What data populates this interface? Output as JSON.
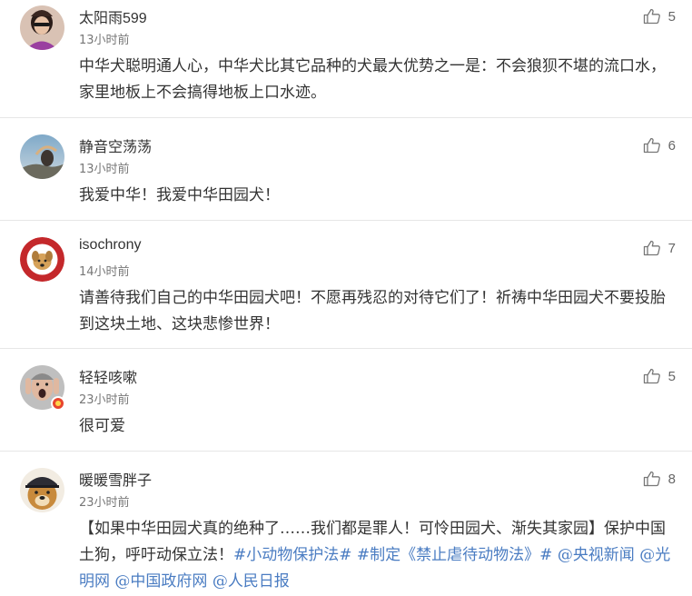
{
  "comments": [
    {
      "username": "太阳雨599",
      "time": "13小时前",
      "likes": "5",
      "text": "中华犬聪明通人心，中华犬比其它品种的犬最大优势之一是：不会狼狈不堪的流口水，家里地板上不会搞得地板上口水迹。",
      "avatar": "avatar-woman-sunglasses"
    },
    {
      "username": "静音空荡荡",
      "time": "13小时前",
      "likes": "6",
      "text": "我爱中华！我爱中华田园犬！",
      "avatar": "avatar-sky-photo"
    },
    {
      "username": "isochrony",
      "time": "14小时前",
      "likes": "7",
      "text": "请善待我们自己的中华田园犬吧！不愿再残忍的对待它们了！祈祷中华田园犬不要投胎到这块土地、这块悲惨世界！",
      "avatar": "avatar-dog-badge"
    },
    {
      "username": "轻轻咳嗽",
      "time": "23小时前",
      "likes": "5",
      "text": "很可爱",
      "avatar": "avatar-screaming-man"
    },
    {
      "username": "暖暖雪胖子",
      "time": "23小时前",
      "likes": "8",
      "text_parts": [
        "【如果中华田园犬真的绝种了……我们都是罪人！可怜田园犬、渐失其家园】保护中国土狗，呼吁动保立法！",
        "#小动物保护法#",
        " ",
        "#制定《禁止虐待动物法》#",
        " ",
        "@央视新闻",
        " ",
        "@光明网",
        " ",
        "@中国政府网",
        " ",
        "@人民日报"
      ],
      "avatar": "avatar-dog-cap"
    }
  ],
  "colors": {
    "link": "#4a7cc2",
    "divider": "#e6e6e6",
    "time": "#777777"
  },
  "icons": {
    "like": "thumbs-up-icon"
  }
}
